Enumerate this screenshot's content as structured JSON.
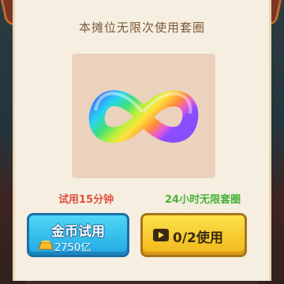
{
  "dialog": {
    "title": "本摊位无限次使用套圈"
  },
  "item": {
    "icon": "rainbow-infinity-ring"
  },
  "options": {
    "trial": {
      "label": "试用15分钟",
      "button_label": "金币试用",
      "cost": "2750亿",
      "cost_icon": "gold-bar-icon"
    },
    "video": {
      "label": "24小时无限套圈",
      "button_label": "0/2使用",
      "icon": "video-play-icon"
    }
  },
  "colors": {
    "trial_label": "#e0503c",
    "video_label": "#4ab23a",
    "coin_button": "#22a9e2",
    "video_button": "#f2b61a",
    "panel_bg": "#f6efe1"
  }
}
